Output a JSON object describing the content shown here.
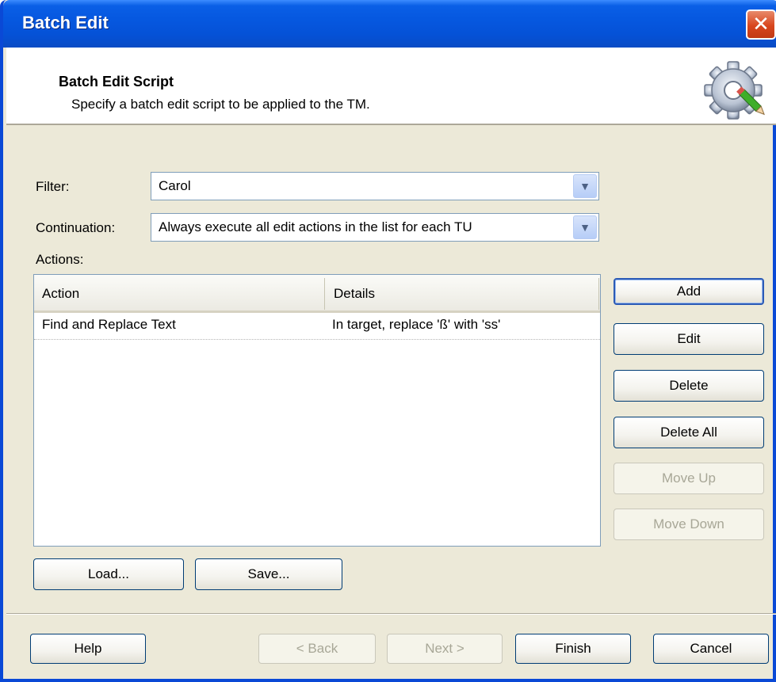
{
  "window": {
    "title": "Batch Edit",
    "close_symbol": "✕"
  },
  "header": {
    "title": "Batch Edit Script",
    "description": "Specify a batch edit script to be applied to the TM.",
    "icon": "gear-pencil-icon"
  },
  "filter": {
    "label": "Filter:",
    "value": "Carol"
  },
  "continuation": {
    "label": "Continuation:",
    "value": "Always execute all edit actions in the list for each TU"
  },
  "actions": {
    "label": "Actions:",
    "columns": [
      "Action",
      "Details"
    ],
    "rows": [
      {
        "action": "Find and Replace Text",
        "details": "In target, replace 'ß' with 'ss'"
      }
    ]
  },
  "side_buttons": {
    "add": "Add",
    "edit": "Edit",
    "delete": "Delete",
    "delete_all": "Delete All",
    "move_up": "Move Up",
    "move_down": "Move Down"
  },
  "file_buttons": {
    "load": "Load...",
    "save": "Save..."
  },
  "footer_buttons": {
    "help": "Help",
    "back": "< Back",
    "next": "Next >",
    "finish": "Finish",
    "cancel": "Cancel"
  },
  "colors": {
    "titlebar": "#0658e0",
    "dialog_bg": "#ece9d8",
    "button_border": "#003c74"
  }
}
